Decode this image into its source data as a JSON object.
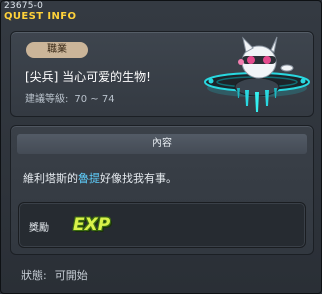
{
  "quest": {
    "id": "23675-0",
    "window_title": "QUEST INFO",
    "job_tag": "職業",
    "name": "[尖兵] 当心可爱的生物!",
    "recommended_level_label": "建議等級:",
    "recommended_level_value": "70 ~ 74"
  },
  "content": {
    "header": "內容",
    "desc_before": "維利塔斯的",
    "desc_highlight": "魯提",
    "desc_after": "好像找我有事。",
    "reward_label": "獎勵",
    "reward_item": "EXP"
  },
  "status": {
    "label": "狀態:",
    "value": "可開始"
  },
  "colors": {
    "title": "#ffd23a",
    "highlight": "#5fd0ff",
    "exp": "#d9f24a",
    "ufo_glow": "#29d8e0"
  },
  "icons": {
    "npc": "ufo-creature-icon",
    "reward": "exp-icon"
  }
}
